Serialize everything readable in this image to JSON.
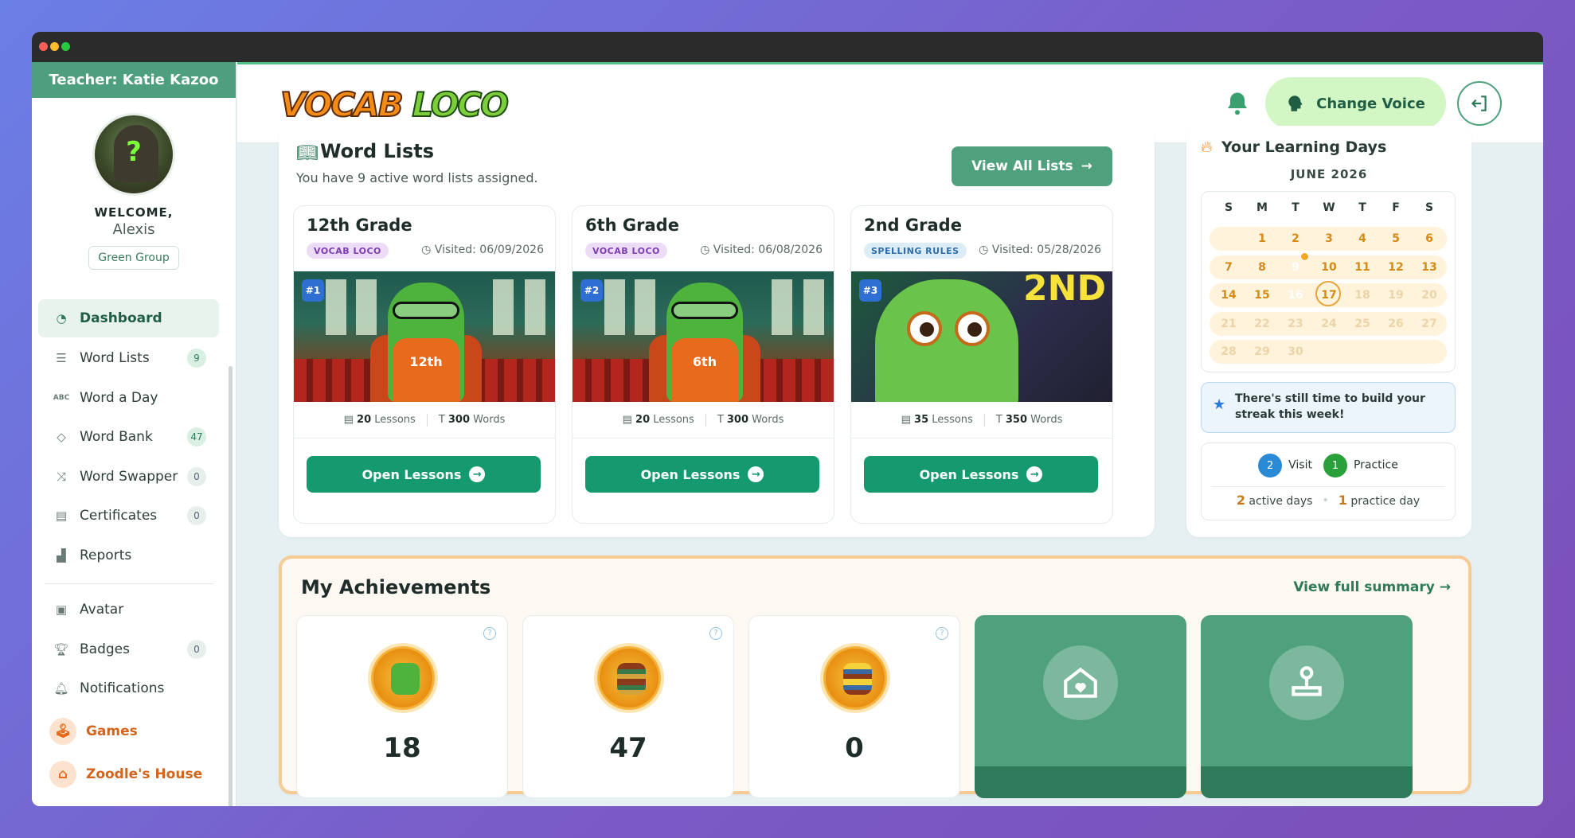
{
  "sidebar": {
    "teacher_label": "Teacher: Katie Kazoo",
    "welcome": "WELCOME,",
    "user_name": "Alexis",
    "group": "Green Group",
    "items": [
      {
        "label": "Dashboard",
        "icon": "dashboard-icon",
        "count": ""
      },
      {
        "label": "Word Lists",
        "icon": "list-icon",
        "count": "9"
      },
      {
        "label": "Word a Day",
        "icon": "abc-icon",
        "count": ""
      },
      {
        "label": "Word Bank",
        "icon": "diamond-icon",
        "count": "47"
      },
      {
        "label": "Word Swapper",
        "icon": "shuffle-icon",
        "count": "0"
      },
      {
        "label": "Certificates",
        "icon": "certificate-icon",
        "count": "0"
      },
      {
        "label": "Reports",
        "icon": "bar-chart-icon",
        "count": ""
      },
      {
        "label": "Avatar",
        "icon": "avatar-icon",
        "count": ""
      },
      {
        "label": "Badges",
        "icon": "trophy-icon",
        "count": "0"
      },
      {
        "label": "Notifications",
        "icon": "bell-icon",
        "count": ""
      },
      {
        "label": "Games",
        "icon": "joystick-icon",
        "count": ""
      },
      {
        "label": "Zoodle's House",
        "icon": "house-icon",
        "count": ""
      }
    ]
  },
  "header": {
    "logo_word1": "VOCAB",
    "logo_word2": "LOCO",
    "change_voice": "Change Voice"
  },
  "word_lists": {
    "title": "Word Lists",
    "subtitle": "You have 9 active word lists assigned.",
    "view_all": "View All Lists",
    "cards": [
      {
        "title": "12th Grade",
        "tag": "VOCAB LOCO",
        "visited": "Visited: 06/09/2026",
        "num": "#1",
        "shirt": "12th",
        "lessons": "20",
        "lessons_label": "Lessons",
        "words": "300",
        "words_label": "Words",
        "open": "Open Lessons"
      },
      {
        "title": "6th Grade",
        "tag": "VOCAB LOCO",
        "visited": "Visited: 06/08/2026",
        "num": "#2",
        "shirt": "6th",
        "lessons": "20",
        "lessons_label": "Lessons",
        "words": "300",
        "words_label": "Words",
        "open": "Open Lessons"
      },
      {
        "title": "2nd Grade",
        "tag": "SPELLING RULES",
        "visited": "Visited: 05/28/2026",
        "num": "#3",
        "shirt": "2ND",
        "lessons": "35",
        "lessons_label": "Lessons",
        "words": "350",
        "words_label": "Words",
        "open": "Open Lessons"
      }
    ]
  },
  "learning_days": {
    "title": "Your Learning Days",
    "month": "JUNE 2026",
    "dow": [
      "S",
      "M",
      "T",
      "W",
      "T",
      "F",
      "S"
    ],
    "streak_message": "There's still time to build your streak this week!",
    "legend_visit": "Visit",
    "legend_visit_count": "2",
    "legend_practice": "Practice",
    "legend_practice_count": "1",
    "active_days_num": "2",
    "active_days_label": "active days",
    "practice_day_num": "1",
    "practice_day_label": "practice day"
  },
  "achievements": {
    "title": "My Achievements",
    "view_full": "View full summary",
    "stats": [
      "18",
      "47",
      "0"
    ]
  }
}
